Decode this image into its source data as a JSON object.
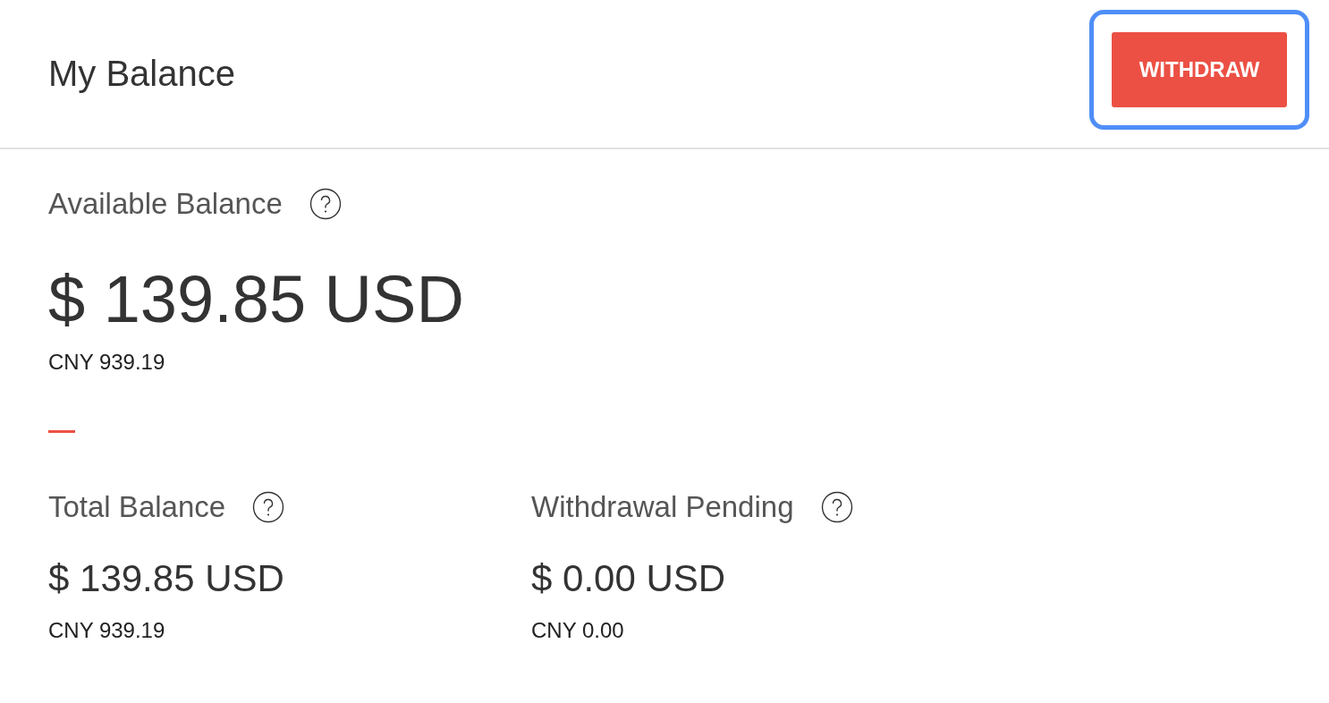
{
  "header": {
    "title": "My Balance",
    "button": {
      "label": "WITHDRAW",
      "focused": true
    }
  },
  "available": {
    "label": "Available Balance",
    "amount": "$ 139.85 USD",
    "converted": "CNY 939.19"
  },
  "stats": [
    {
      "label": "Total Balance",
      "amount": "$ 139.85 USD",
      "converted": "CNY 939.19"
    },
    {
      "label": "Withdrawal Pending",
      "amount": "$ 0.00 USD",
      "converted": "CNY 0.00"
    }
  ]
}
